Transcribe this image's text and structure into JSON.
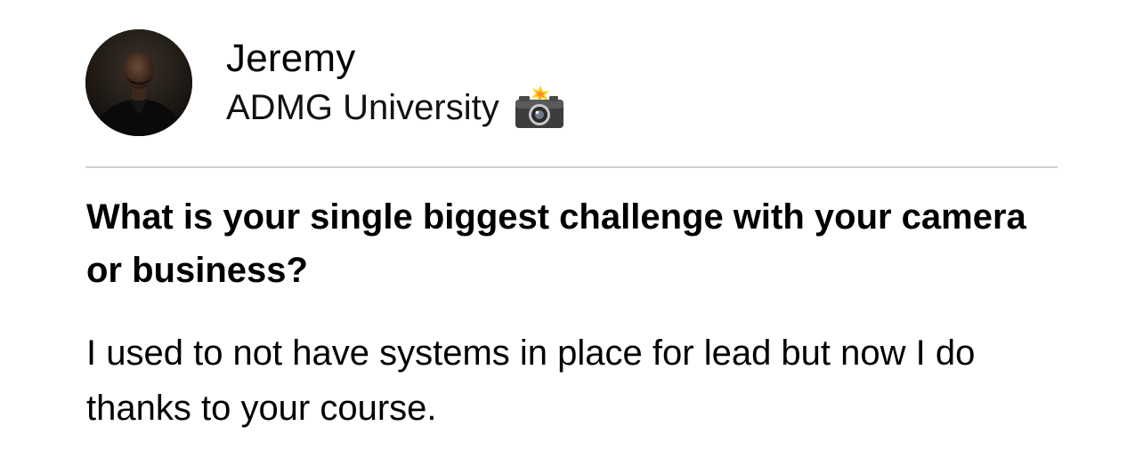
{
  "post": {
    "author_name": "Jeremy",
    "organization": "ADMG University",
    "organization_icon": "camera-with-flash-icon",
    "question": "What is your single biggest challenge with your camera or business?",
    "answer": "I used to not have systems in place for lead but now I do thanks to your course."
  },
  "colors": {
    "background": "#ffffff",
    "text": "#000000",
    "divider": "#d0d0d0"
  }
}
